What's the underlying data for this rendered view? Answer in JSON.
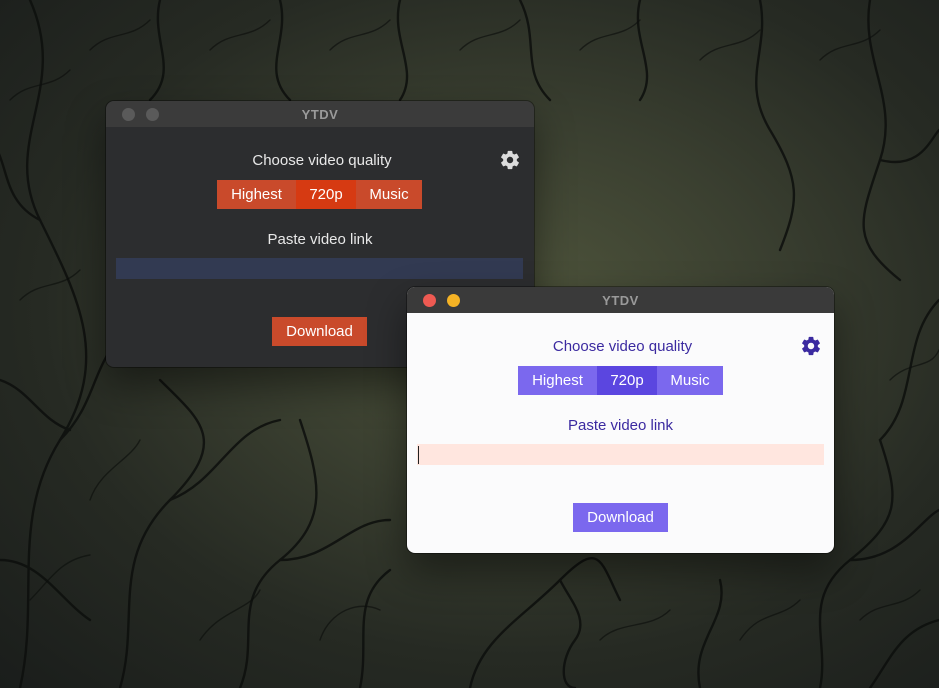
{
  "colors": {
    "dark_accent": "#c94a2b",
    "dark_accent_selected": "#d63a12",
    "dark_input_bg": "#323a52",
    "light_accent": "#7b68ee",
    "light_accent_selected": "#5b46e0",
    "light_text": "#3b2aa0",
    "light_input_bg": "#ffe6df",
    "close_red": "#ee5a52",
    "minimize_yellow": "#f5b325",
    "inactive_gray": "#5a5a5a"
  },
  "dark_window": {
    "title": "YTDV",
    "quality_heading": "Choose video quality",
    "quality_options": [
      "Highest",
      "720p",
      "Music"
    ],
    "selected_quality": "720p",
    "link_heading": "Paste video link",
    "link_value": "",
    "download_label": "Download",
    "settings_icon": "gear-icon"
  },
  "light_window": {
    "title": "YTDV",
    "quality_heading": "Choose video quality",
    "quality_options": [
      "Highest",
      "720p",
      "Music"
    ],
    "selected_quality": "720p",
    "link_heading": "Paste video link",
    "link_value": "",
    "download_label": "Download",
    "settings_icon": "gear-icon"
  }
}
